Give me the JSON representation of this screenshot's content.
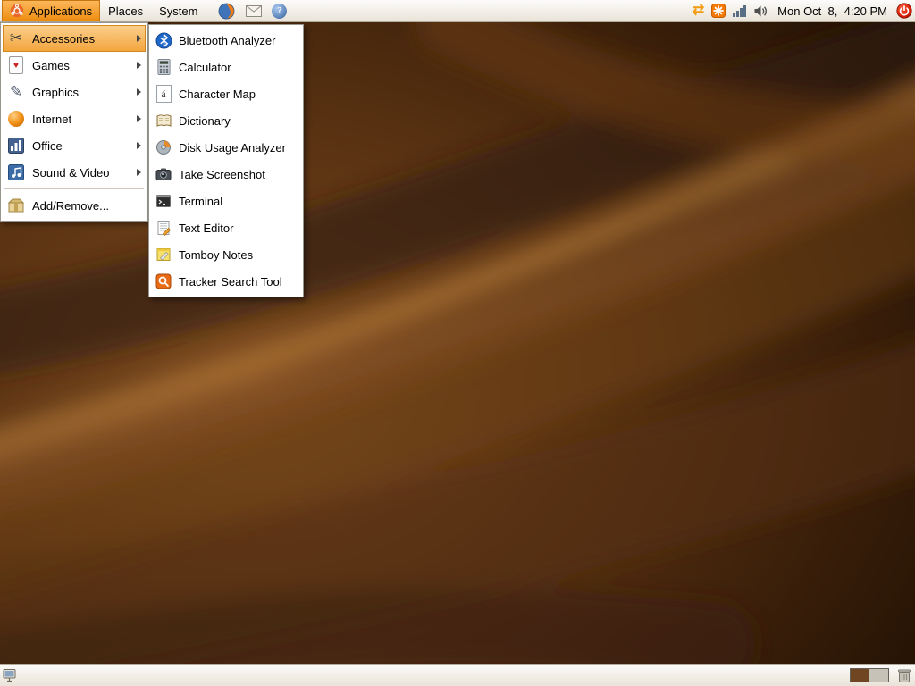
{
  "colors": {
    "accent": "#f57900",
    "menu_highlight": "#f3a43b",
    "panel": "#efe9df",
    "desktop_base": "#55300f",
    "power_red": "#d81e05"
  },
  "top_panel": {
    "menus": [
      {
        "label": "Applications",
        "icon": "ubuntu-logo-icon"
      },
      {
        "label": "Places"
      },
      {
        "label": "System"
      }
    ],
    "launchers": [
      {
        "name": "firefox-launcher",
        "icon": "firefox-icon"
      },
      {
        "name": "email-launcher",
        "icon": "email-icon"
      },
      {
        "name": "help-launcher",
        "icon": "help-icon"
      }
    ],
    "tray_icons": [
      {
        "icon": "network-transfer-icon"
      },
      {
        "icon": "software-update-icon"
      },
      {
        "icon": "signal-strength-icon"
      },
      {
        "icon": "volume-icon"
      }
    ],
    "clock": "Mon Oct  8,  4:20 PM",
    "power_icon": "power-button-icon"
  },
  "applications_menu": {
    "categories": [
      {
        "label": "Accessories",
        "icon": "accessories-icon",
        "highlighted": true,
        "has_submenu": true
      },
      {
        "label": "Games",
        "icon": "games-icon",
        "has_submenu": true
      },
      {
        "label": "Graphics",
        "icon": "graphics-icon",
        "has_submenu": true
      },
      {
        "label": "Internet",
        "icon": "internet-icon",
        "has_submenu": true
      },
      {
        "label": "Office",
        "icon": "office-icon",
        "has_submenu": true
      },
      {
        "label": "Sound & Video",
        "icon": "sound-video-icon",
        "has_submenu": true
      }
    ],
    "add_remove": {
      "label": "Add/Remove...",
      "icon": "add-remove-icon"
    }
  },
  "accessories_submenu": {
    "items": [
      {
        "label": "Bluetooth Analyzer",
        "icon": "bluetooth-icon"
      },
      {
        "label": "Calculator",
        "icon": "calculator-icon"
      },
      {
        "label": "Character Map",
        "icon": "character-map-icon"
      },
      {
        "label": "Dictionary",
        "icon": "dictionary-icon"
      },
      {
        "label": "Disk Usage Analyzer",
        "icon": "disk-usage-icon"
      },
      {
        "label": "Take Screenshot",
        "icon": "screenshot-icon"
      },
      {
        "label": "Terminal",
        "icon": "terminal-icon"
      },
      {
        "label": "Text Editor",
        "icon": "text-editor-icon"
      },
      {
        "label": "Tomboy Notes",
        "icon": "tomboy-notes-icon"
      },
      {
        "label": "Tracker Search Tool",
        "icon": "tracker-search-icon"
      }
    ]
  },
  "bottom_panel": {
    "workspaces": {
      "count": 2,
      "active": 1
    },
    "icons": [
      "show-desktop-icon",
      "trash-icon"
    ]
  }
}
